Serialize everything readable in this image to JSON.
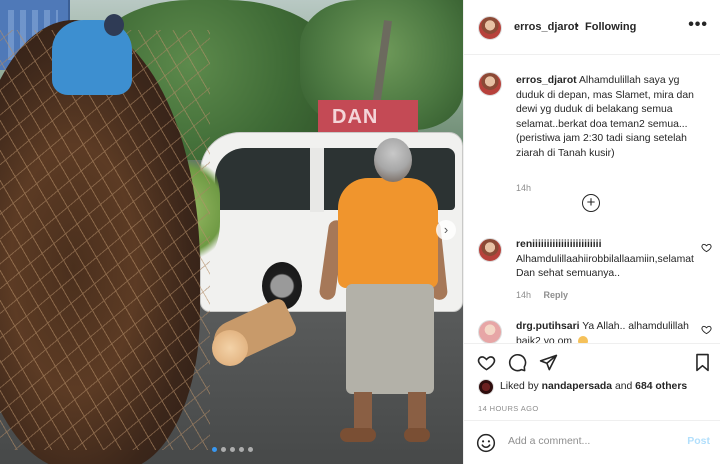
{
  "post": {
    "username": "erros_djarot",
    "separator": "•",
    "follow_status": "Following",
    "more_label": "•••",
    "photo_sign_text": "DAN",
    "caption": {
      "username": "erros_djarot",
      "text": "Alhamdulillah saya yg duduk di depan, mas Slamet, mira dan dewi yg duduk di belakang semua selamat..berkat doa teman2 semua...(peristiwa jam 2:30 tadi siang setelah ziarah di Tanah kusir)",
      "time": "14h"
    },
    "load_more_label": "+",
    "comments": [
      {
        "username": "reniiiiiiiiiiiiiiiiiiiiiiii",
        "text": "Alhamdulillaahiirobbilallaamiin,selamat Dan sehat semuanya..",
        "time": "14h",
        "reply_label": "Reply"
      },
      {
        "username": "drg.putihsari",
        "text": "Ya Allah.. alhamdulillah baik2 yo om",
        "time": "",
        "reply_label": ""
      }
    ],
    "likes": {
      "liked_by_prefix": "Liked by",
      "liked_by_user": "nandapersada",
      "and_label": "and",
      "others_label": "684 others"
    },
    "time_ago": "14 HOURS AGO",
    "add_comment_placeholder": "Add a comment...",
    "post_button": "Post",
    "carousel": {
      "total": 5,
      "active": 0
    }
  },
  "colors": {
    "accent": "#3897f0",
    "post_disabled": "#b2dffc",
    "text_primary": "#262626",
    "text_secondary": "#8e8e8e",
    "shirt_orange": "#f0952d"
  }
}
